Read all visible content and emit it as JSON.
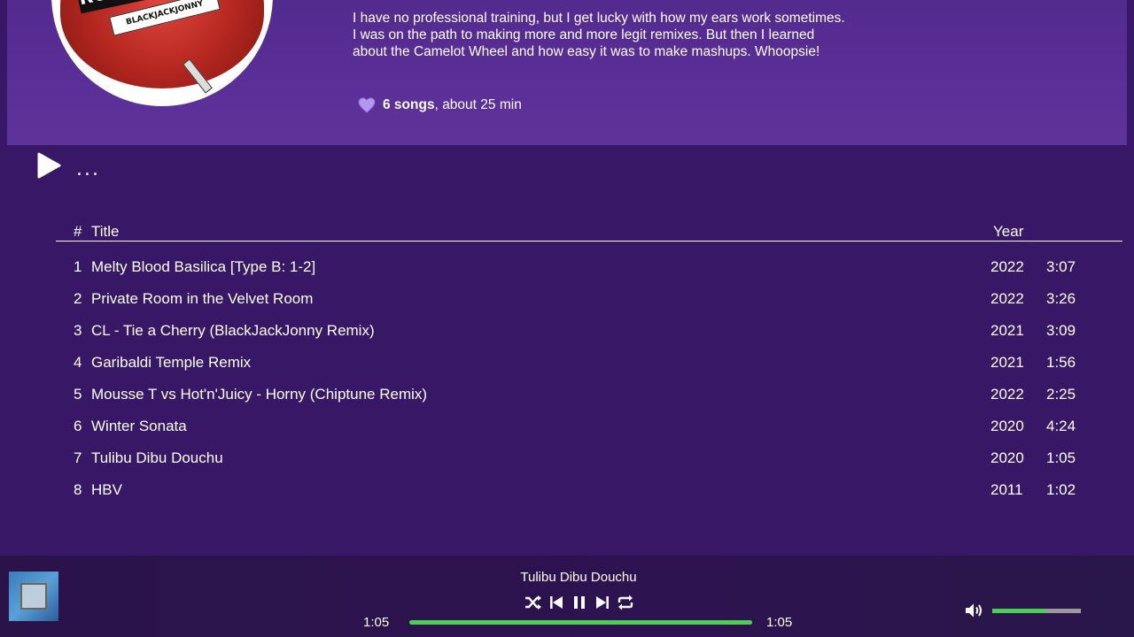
{
  "album": {
    "cover_title": "RUTHLESS LOVE",
    "cover_subtitle": "BLACKJACKJONNY",
    "description": "I have no professional training, but I get lucky with how my ears work sometimes. I was on the path to making more and more legit remixes. But then I learned about the Camelot Wheel and how easy it was to make mashups. Whoopsie!",
    "song_count": "6 songs",
    "duration_text": ", about 25 min",
    "heart_icon": "heart-icon",
    "heart_color": "#b497f0"
  },
  "controls": {
    "play_icon": "play-icon",
    "more_label": "..."
  },
  "table": {
    "headers": {
      "number": "#",
      "title": "Title",
      "year": "Year"
    },
    "rows": [
      {
        "num": "1",
        "title": "Melty Blood Basilica [Type B: 1-2]",
        "year": "2022",
        "duration": "3:07"
      },
      {
        "num": "2",
        "title": "Private Room in the Velvet Room",
        "year": "2022",
        "duration": "3:26"
      },
      {
        "num": "3",
        "title": "CL - Tie a Cherry (BlackJackJonny Remix)",
        "year": "2021",
        "duration": "3:09"
      },
      {
        "num": "4",
        "title": "Garibaldi Temple Remix",
        "year": "2021",
        "duration": "1:56"
      },
      {
        "num": "5",
        "title": "Mousse T vs Hot'n'Juicy - Horny (Chiptune Remix)",
        "year": "2022",
        "duration": "2:25"
      },
      {
        "num": "6",
        "title": "Winter Sonata",
        "year": "2020",
        "duration": "4:24"
      },
      {
        "num": "7",
        "title": "Tulibu Dibu Douchu",
        "year": "2020",
        "duration": "1:05"
      },
      {
        "num": "8",
        "title": "HBV",
        "year": "2011",
        "duration": "1:02"
      }
    ]
  },
  "player": {
    "now_playing": "Tulibu Dibu Douchu",
    "elapsed": "1:05",
    "total": "1:05",
    "progress": 1.0,
    "volume": 0.6,
    "accent_color": "#4ccf52",
    "icons": [
      "shuffle-icon",
      "previous-icon",
      "pause-icon",
      "next-icon",
      "repeat-icon",
      "volume-icon"
    ]
  }
}
